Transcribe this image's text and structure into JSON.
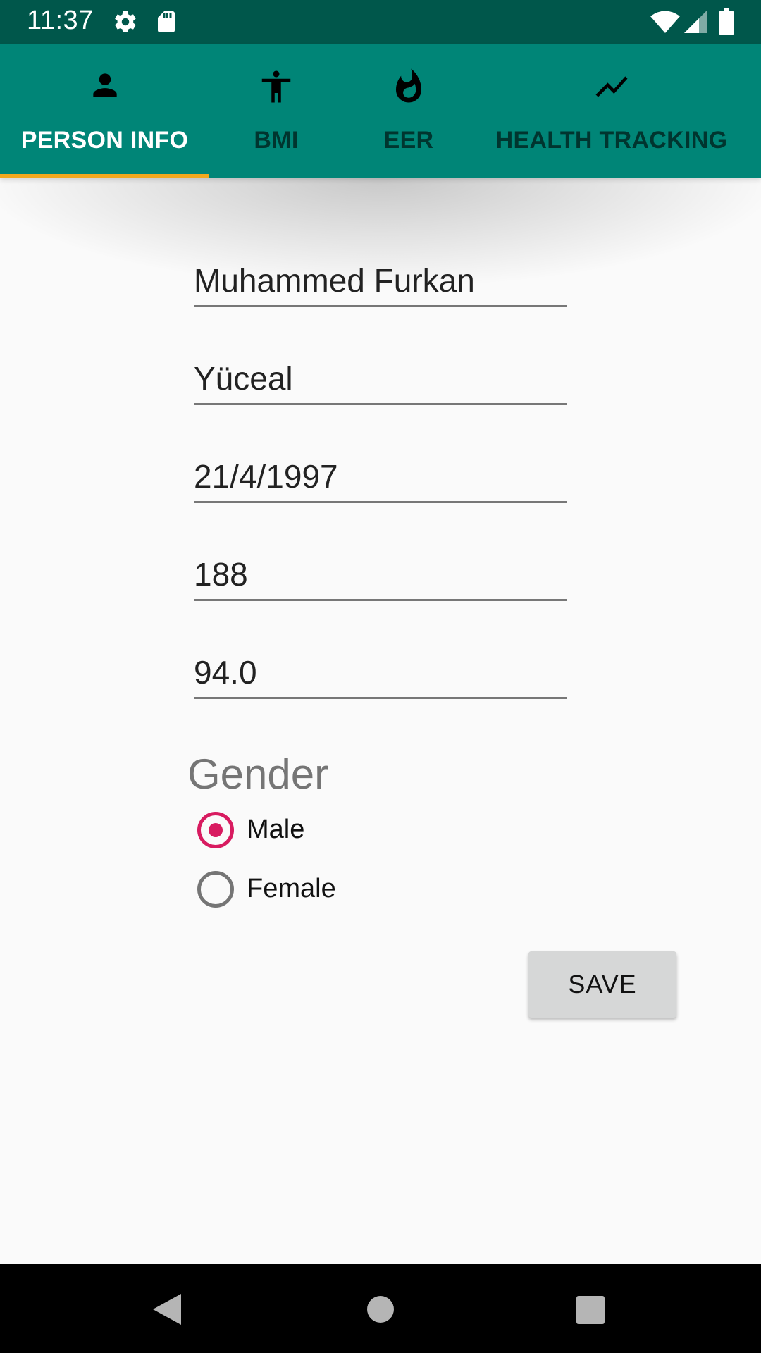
{
  "status_bar": {
    "time": "11:37",
    "icons": [
      "settings-gear-icon",
      "sd-card-icon",
      "wifi-icon",
      "cell-signal-icon",
      "battery-icon"
    ]
  },
  "tabs": [
    {
      "label": "PERSON INFO",
      "icon": "person-icon",
      "active": true
    },
    {
      "label": "BMI",
      "icon": "accessibility-icon",
      "active": false
    },
    {
      "label": "EER",
      "icon": "flame-icon",
      "active": false
    },
    {
      "label": "HEALTH TRACKING",
      "icon": "trending-line-icon",
      "active": false
    }
  ],
  "form": {
    "first_name": "Muhammed Furkan",
    "last_name": "Yüceal",
    "birth_date": "21/4/1997",
    "height": "188",
    "weight": "94.0",
    "gender_label": "Gender",
    "gender_options": [
      {
        "label": "Male",
        "checked": true
      },
      {
        "label": "Female",
        "checked": false
      }
    ],
    "save_label": "SAVE"
  },
  "nav_bar": {
    "icons": [
      "back-triangle-icon",
      "home-circle-icon",
      "recents-square-icon"
    ]
  },
  "colors": {
    "status_bar": "#00574b",
    "app_bar": "#008577",
    "tab_indicator": "#f2a81d",
    "radio_accent": "#d81b60"
  }
}
